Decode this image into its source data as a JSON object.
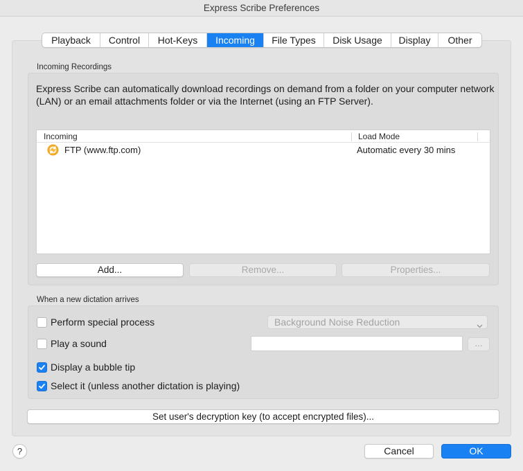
{
  "window": {
    "title": "Express Scribe Preferences"
  },
  "tabs": [
    {
      "label": "Playback",
      "active": false
    },
    {
      "label": "Control",
      "active": false
    },
    {
      "label": "Hot-Keys",
      "active": false
    },
    {
      "label": "Incoming",
      "active": true
    },
    {
      "label": "File Types",
      "active": false
    },
    {
      "label": "Disk Usage",
      "active": false
    },
    {
      "label": "Display",
      "active": false
    },
    {
      "label": "Other",
      "active": false
    }
  ],
  "incoming_recordings": {
    "group_label": "Incoming Recordings",
    "description": "Express Scribe can automatically download recordings on demand from a folder on your computer network (LAN) or an email attachments folder or via the Internet (using an FTP Server).",
    "columns": {
      "incoming": "Incoming",
      "load_mode": "Load Mode"
    },
    "rows": [
      {
        "icon": "ftp-sync-icon",
        "incoming": "FTP (www.ftp.com)",
        "load_mode": "Automatic every 30 mins"
      }
    ],
    "buttons": {
      "add": "Add...",
      "remove": "Remove...",
      "properties": "Properties..."
    }
  },
  "new_dictation": {
    "group_label": "When a new dictation arrives",
    "perform_special_process": {
      "label": "Perform special process",
      "checked": false
    },
    "special_process_select": {
      "value": "Background Noise Reduction"
    },
    "play_sound": {
      "label": "Play a sound",
      "checked": false,
      "value": ""
    },
    "browse_label": "...",
    "bubble_tip": {
      "label": "Display a bubble tip",
      "checked": true
    },
    "select_it": {
      "label": "Select it (unless another dictation is playing)",
      "checked": true
    }
  },
  "decryption_button": "Set user's decryption key (to accept encrypted files)...",
  "footer": {
    "help": "?",
    "cancel": "Cancel",
    "ok": "OK"
  },
  "colors": {
    "accent": "#1a81f3",
    "ftp_icon": "#f0a31d"
  }
}
